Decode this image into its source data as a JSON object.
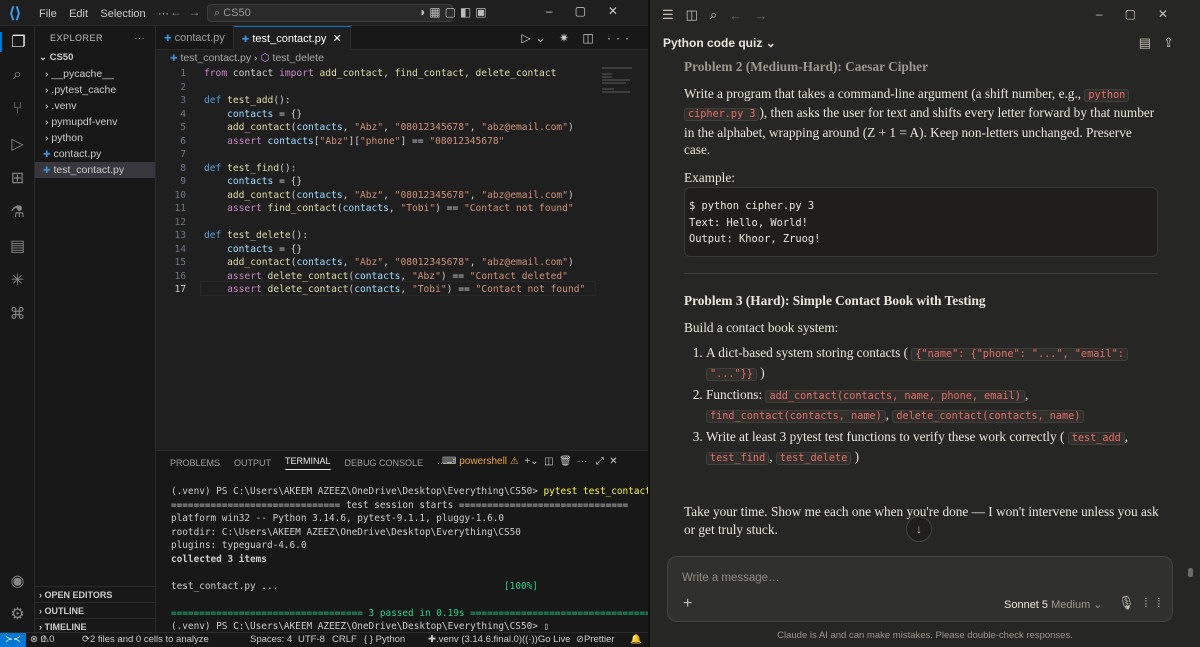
{
  "vscode": {
    "menu": [
      "File",
      "Edit",
      "Selection",
      "···"
    ],
    "search_placeholder": "CS50",
    "explorer_title": "EXPLORER",
    "root_folder": "CS50",
    "tree": [
      {
        "label": "__pycache__",
        "kind": "folder"
      },
      {
        "label": ".pytest_cache",
        "kind": "folder"
      },
      {
        "label": ".venv",
        "kind": "folder"
      },
      {
        "label": "pymupdf-venv",
        "kind": "folder"
      },
      {
        "label": "python",
        "kind": "folder"
      },
      {
        "label": "contact.py",
        "kind": "file"
      },
      {
        "label": "test_contact.py",
        "kind": "file",
        "selected": true
      }
    ],
    "sidebar_sections": [
      "OPEN EDITORS",
      "OUTLINE",
      "TIMELINE"
    ],
    "tabs": [
      {
        "label": "contact.py",
        "active": false
      },
      {
        "label": "test_contact.py",
        "active": true
      }
    ],
    "breadcrumb": {
      "file": "test_contact.py",
      "symbol": "test_delete"
    },
    "code_lines": [
      "from contact import add_contact, find_contact, delete_contact",
      "",
      "def test_add():",
      "    contacts = {}",
      "    add_contact(contacts, \"Abz\", \"08012345678\", \"abz@email.com\")",
      "    assert contacts[\"Abz\"][\"phone\"] == \"08012345678\"",
      "",
      "def test_find():",
      "    contacts = {}",
      "    add_contact(contacts, \"Abz\", \"08012345678\", \"abz@email.com\")",
      "    assert find_contact(contacts, \"Tobi\") == \"Contact not found\"",
      "",
      "def test_delete():",
      "    contacts = {}",
      "    add_contact(contacts, \"Abz\", \"08012345678\", \"abz@email.com\")",
      "    assert delete_contact(contacts, \"Abz\") == \"Contact deleted\"",
      "    assert delete_contact(contacts, \"Tobi\") == \"Contact not found\""
    ],
    "current_line": 17,
    "panel_tabs": [
      "PROBLEMS",
      "OUTPUT",
      "TERMINAL",
      "DEBUG CONSOLE",
      "···"
    ],
    "active_panel_tab": "TERMINAL",
    "terminal_shell": "powershell",
    "terminal": {
      "prompt1": "(.venv) PS C:\\Users\\AKEEM AZEEZ\\OneDrive\\Desktop\\Everything\\CS50>",
      "cmd1": "pytest test_contact.py",
      "session": "============================== test session starts ==============================",
      "platform": "platform win32 -- Python 3.14.6, pytest-9.1.1, pluggy-1.6.0",
      "rootdir": "rootdir: C:\\Users\\AKEEM AZEEZ\\OneDrive\\Desktop\\Everything\\CS50",
      "plugins": "plugins: typeguard-4.6.0",
      "collected": "collected 3 items",
      "result_file": "test_contact.py ...",
      "result_pct": "[100%]",
      "passed": "================================== 3 passed in 0.19s ==================================",
      "prompt2": "(.venv) PS C:\\Users\\AKEEM AZEEZ\\OneDrive\\Desktop\\Everything\\CS50>"
    },
    "status": {
      "errors": "0",
      "warnings": "0",
      "analysis": "2 files and 0 cells to analyze",
      "spaces": "Spaces: 4",
      "encoding": "UTF-8",
      "eol": "CRLF",
      "language": "{ } Python",
      "interpreter": ".venv (3.14.6.final.0)",
      "golive": "Go Live",
      "prettier": "Prettier"
    }
  },
  "claude": {
    "title": "Python code quiz",
    "problem2_heading": "Problem 2 (Medium-Hard): Caesar Cipher",
    "p2_text_a": "Write a program that takes a command-line argument (a shift number, e.g.,",
    "p2_code_a": "python",
    "p2_code_b": "cipher.py 3",
    "p2_text_b": "), then asks the user for text and shifts every letter forward by that number in the alphabet, wrapping around (Z + 1 = A). Keep non-letters unchanged. Preserve case.",
    "example_label": "Example:",
    "example_code": "$ python cipher.py 3\nText: Hello, World!\nOutput: Khoor, Zruog!",
    "problem3_heading": "Problem 3 (Hard): Simple Contact Book with Testing",
    "p3_intro": "Build a contact book system:",
    "item1_text": "A dict-based system storing contacts (",
    "item1_code_a": "{\"name\": {\"phone\": \"...\", \"email\":",
    "item1_code_b": "\"...\"}}",
    "item2_text": "Functions:",
    "item2_code_a": "add_contact(contacts, name, phone, email)",
    "item2_code_b": "find_contact(contacts, name)",
    "item2_code_c": "delete_contact(contacts, name)",
    "item3_text": "Write at least 3 pytest test functions to verify these work correctly (",
    "item3_code_a": "test_add",
    "item3_code_b": "test_find",
    "item3_code_c": "test_delete",
    "closing": "Take your time. Show me each one when you're done — I won't intervene unless you ask or get truly stuck.",
    "composer_placeholder": "Write a message…",
    "model_name": "Sonnet 5",
    "model_mode": "Medium",
    "disclaimer": "Claude is AI and can make mistakes. Please double-check responses."
  }
}
